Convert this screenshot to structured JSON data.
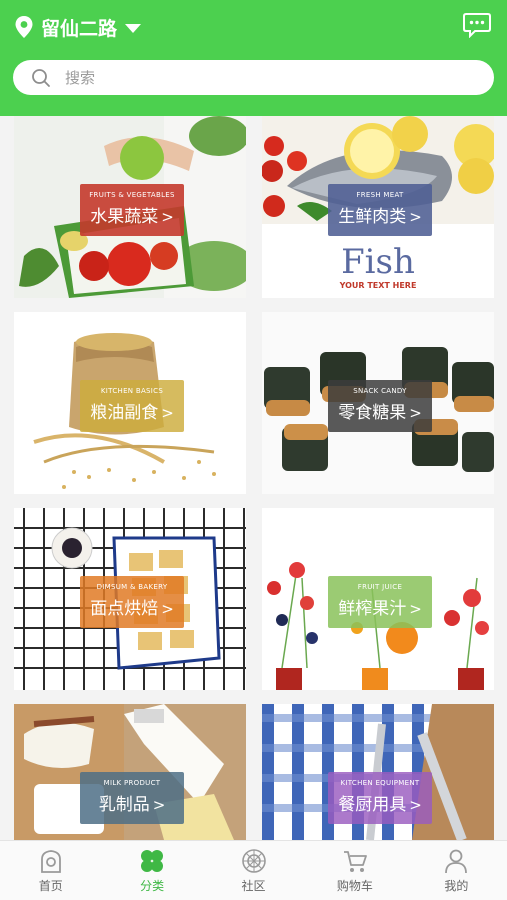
{
  "location": {
    "city": "留仙二路"
  },
  "search": {
    "placeholder": "搜索"
  },
  "categories": [
    {
      "en": "FRUITS & VEGETABLES",
      "zh": "水果蔬菜",
      "label_color": "#c43a2c"
    },
    {
      "en": "FRESH MEAT",
      "zh": "生鲜肉类",
      "label_color": "#4f5e94",
      "poster_title": "Fish",
      "poster_sub": "YOUR TEXT HERE"
    },
    {
      "en": "KITCHEN BASICS",
      "zh": "粮油副食",
      "label_color": "#c9a93a"
    },
    {
      "en": "SNACK CANDY",
      "zh": "零食糖果",
      "label_color": "#4a4a4a"
    },
    {
      "en": "DIMSUM & BAKERY",
      "zh": "面点烘焙",
      "label_color": "#e07a25"
    },
    {
      "en": "FRUIT JUICE",
      "zh": "鲜榨果汁",
      "label_color": "#8ac25a"
    },
    {
      "en": "MILK PRODUCT",
      "zh": "乳制品",
      "label_color": "#4e6f86"
    },
    {
      "en": "KITCHEN EQUIPMENT",
      "zh": "餐厨用具",
      "label_color": "#9a5cc0"
    }
  ],
  "chevron": ">",
  "tabs": [
    {
      "label": "首页",
      "icon": "home-icon"
    },
    {
      "label": "分类",
      "icon": "category-icon"
    },
    {
      "label": "社区",
      "icon": "community-icon"
    },
    {
      "label": "购物车",
      "icon": "cart-icon"
    },
    {
      "label": "我的",
      "icon": "user-icon"
    }
  ],
  "colors": {
    "brand": "#4cd04f",
    "tab_active": "#3fb845"
  }
}
